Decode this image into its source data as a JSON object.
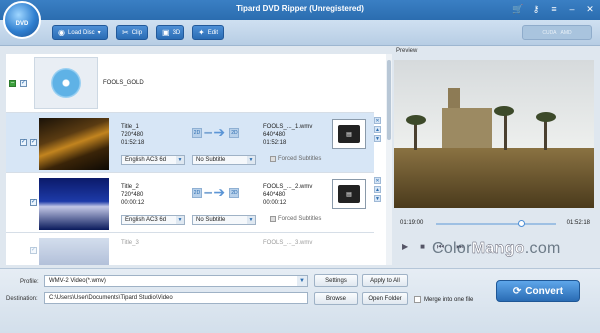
{
  "window": {
    "title": "Tipard DVD Ripper (Unregistered)",
    "logo_text": "DVD"
  },
  "toolbar": {
    "load_disc": "Load Disc",
    "clip": "Clip",
    "three_d": "3D",
    "edit": "Edit",
    "cuda": "CUDA",
    "amd": "AMD"
  },
  "source": {
    "name": "FOOLS_GOLD"
  },
  "titles": [
    {
      "title": "Title_1",
      "resolution": "720*480",
      "duration": "01:52:18",
      "output_name": "FOOLS_..._1.wmv",
      "output_res": "640*480",
      "output_dur": "01:52:18",
      "audio": "English AC3 6d",
      "subtitle": "No Subtitle",
      "forced": "Forced Subtitles"
    },
    {
      "title": "Title_2",
      "resolution": "720*480",
      "duration": "00:00:12",
      "output_name": "FOOLS_..._2.wmv",
      "output_res": "640*480",
      "output_dur": "00:00:12",
      "audio": "English AC3 6d",
      "subtitle": "No Subtitle",
      "forced": "Forced Subtitles"
    },
    {
      "title": "Title_3",
      "output_name": "FOOLS_..._3.wmv"
    }
  ],
  "preview": {
    "label": "Preview",
    "current_time": "01:19:00",
    "total_time": "01:52:18",
    "progress": 0.7
  },
  "bottom": {
    "profile_label": "Profile:",
    "profile_value": "WMV-2 Video(*.wmv)",
    "settings": "Settings",
    "apply_all": "Apply to All",
    "dest_label": "Destination:",
    "dest_value": "C:\\Users\\User\\Documents\\Tipard Studio\\Video",
    "browse": "Browse",
    "open_folder": "Open Folder",
    "merge": "Merge into one file",
    "convert": "Convert"
  },
  "watermark": {
    "a": "Color",
    "b": "Mango",
    "c": ".com"
  }
}
